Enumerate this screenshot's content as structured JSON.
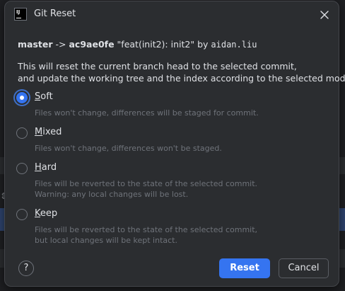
{
  "window": {
    "title": "Git Reset",
    "app_icon_text": "IJ"
  },
  "commit": {
    "branch": "master",
    "arrow": "->",
    "hash": "ac9ae0fe",
    "message": "\"feat(init2): init2\"",
    "by": "by",
    "author": "aidan.liu"
  },
  "description": {
    "line1": "This will reset the current branch head to the selected commit,",
    "line2": "and update the working tree and the index according to the selected mode:"
  },
  "modes": [
    {
      "mnemonic": "S",
      "label_rest": "oft",
      "checked": true,
      "desc": [
        "Files won't change, differences will be staged for commit."
      ]
    },
    {
      "mnemonic": "M",
      "label_rest": "ixed",
      "checked": false,
      "desc": [
        "Files won't change, differences won't be staged."
      ]
    },
    {
      "mnemonic": "H",
      "label_rest": "ard",
      "checked": false,
      "desc": [
        "Files will be reverted to the state of the selected commit.",
        "Warning: any local changes will be lost."
      ]
    },
    {
      "mnemonic": "K",
      "label_rest": "eep",
      "checked": false,
      "desc": [
        "Files will be reverted to the state of the selected commit,",
        "but local changes will be kept intact."
      ]
    }
  ],
  "buttons": {
    "help": "?",
    "reset": "Reset",
    "cancel": "Cancel"
  },
  "colors": {
    "accent": "#3574f0",
    "dialog_bg": "#2b2d30",
    "text": "#dfe1e5",
    "muted_text": "#6f737a"
  }
}
